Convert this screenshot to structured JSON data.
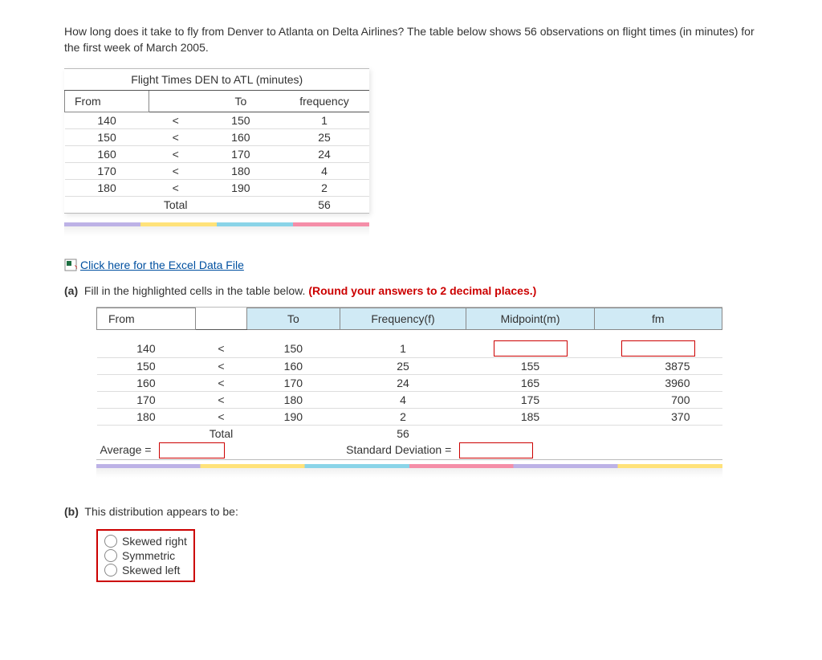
{
  "intro": "How long does it take to fly from Denver to Atlanta on Delta Airlines? The table below shows 56 observations on flight times (in minutes) for the first week of March 2005.",
  "table1": {
    "title": "Flight Times DEN to ATL (minutes)",
    "headers": {
      "from": "From",
      "to": "To",
      "freq": "frequency"
    },
    "lt": "<",
    "rows": [
      {
        "from": "140",
        "to": "150",
        "freq": "1"
      },
      {
        "from": "150",
        "to": "160",
        "freq": "25"
      },
      {
        "from": "160",
        "to": "170",
        "freq": "24"
      },
      {
        "from": "170",
        "to": "180",
        "freq": "4"
      },
      {
        "from": "180",
        "to": "190",
        "freq": "2"
      }
    ],
    "total_label": "Total",
    "total_value": "56"
  },
  "link_text": "Click here for the Excel Data File",
  "part_a": {
    "label": "(a)",
    "text": "Fill in the highlighted cells in the table below.",
    "note": "(Round your answers to 2 decimal places.)"
  },
  "table2": {
    "headers": {
      "from": "From",
      "to": "To",
      "freq": "Frequency(f)",
      "mid": "Midpoint(m)",
      "fm": "fm"
    },
    "lt": "<",
    "rows": [
      {
        "from": "140",
        "to": "150",
        "freq": "1",
        "mid": "",
        "fm": ""
      },
      {
        "from": "150",
        "to": "160",
        "freq": "25",
        "mid": "155",
        "fm": "3875"
      },
      {
        "from": "160",
        "to": "170",
        "freq": "24",
        "mid": "165",
        "fm": "3960"
      },
      {
        "from": "170",
        "to": "180",
        "freq": "4",
        "mid": "175",
        "fm": "700"
      },
      {
        "from": "180",
        "to": "190",
        "freq": "2",
        "mid": "185",
        "fm": "370"
      }
    ],
    "total_label": "Total",
    "total_value": "56",
    "avg_label": "Average =",
    "std_label": "Standard Deviation ="
  },
  "part_b": {
    "label": "(b)",
    "text": "This distribution appears to be:",
    "options": [
      "Skewed right",
      "Symmetric",
      "Skewed left"
    ]
  },
  "chart_data": {
    "type": "table",
    "title": "Flight Times DEN to ATL (minutes) — computation table",
    "columns": [
      "From",
      "To",
      "Frequency(f)",
      "Midpoint(m)",
      "fm"
    ],
    "rows": [
      [
        "140",
        "150",
        1,
        null,
        null
      ],
      [
        "150",
        "160",
        25,
        155,
        3875
      ],
      [
        "160",
        "170",
        24,
        165,
        3960
      ],
      [
        "170",
        "180",
        4,
        175,
        700
      ],
      [
        "180",
        "190",
        2,
        185,
        370
      ]
    ],
    "total_frequency": 56,
    "inputs_expected": [
      "row0_midpoint",
      "row0_fm",
      "average",
      "standard_deviation"
    ]
  }
}
